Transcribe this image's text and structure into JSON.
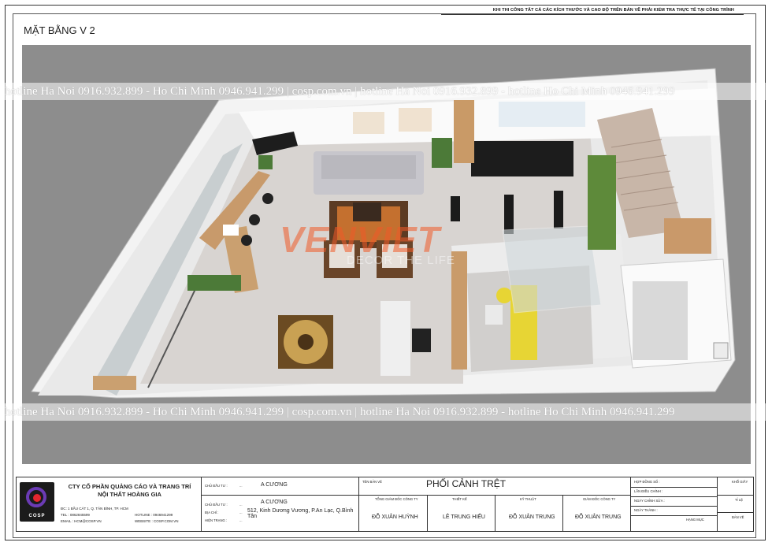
{
  "top_note": "KHI THI CÔNG TẤT CẢ CÁC KÍCH THƯỚC VÀ CAO ĐỘ TRÊN BẢN VẼ PHẢI KIỂM TRA THỰC TẾ TẠI CÔNG TRÌNH",
  "sheet_title": "MẶT BẰNG V 2",
  "hotline_text": "hotline Ha Noi 0916.932.899 - Ho Chi Minh 0946.941.299 | cosp.com.vn | hotline Ha Noi 0916.932.899 - hotline Ho Chi Minh 0946.941.299",
  "watermark": {
    "brand": "VENVIET",
    "tagline": "DECOR THE LIFE"
  },
  "colors": {
    "canvas": "#8d8d8d",
    "wall": "#f2f2f2",
    "floor": "#d9d5d2",
    "accent": "#f05a28",
    "logo_purple": "#6b3bb5",
    "logo_red": "#e3262e"
  },
  "title_block": {
    "company_line1": "CTY CỔ PHẦN QUẢNG CÁO VÀ TRANG TRÍ",
    "company_line2": "NỘI THẤT HOÀNG GIA",
    "logo_text": "COSP",
    "address": "ĐC: 1 BẦU CÁT 1, Q. TÂN BÌNH, TP. HCM",
    "tel_label": "TEL :",
    "tel": "0862845599",
    "hotline_label": "HOTLINE :",
    "hotline": "0946941299",
    "email_label": "EMAIL :",
    "email": "HCM@COSP.VN",
    "website_label": "WEBSITE :",
    "website": "COSP.COM.VN",
    "owner_label": "CHỦ ĐẦU TƯ :",
    "owner_name": "A   CƯƠNG",
    "owner_label2": "CHỦ ĐẦU TƯ :",
    "owner_name2": "A   CƯƠNG",
    "location_label": "ĐỊA CHỈ :",
    "location": "512, Kinh Dương Vương, P.An Lạc, Q.Bình Tân",
    "item_label": "HIỆN TRẠNG :",
    "drawing_name_label": "TÊN BẢN VẼ",
    "drawing_name": "PHỐI CẢNH TRỆT",
    "roles": [
      {
        "label": "TỔNG GIÁM ĐỐC CÔNG TY",
        "name": "ĐỖ XUÂN HUỲNH"
      },
      {
        "label": "THIẾT KẾ",
        "name": "LÊ TRUNG HIẾU"
      },
      {
        "label": "KỸ THUẬT",
        "name": "ĐỖ XUÂN TRUNG"
      },
      {
        "label": "GIÁM ĐỐC CÔNG TY",
        "name": "ĐỖ XUÂN TRUNG"
      }
    ],
    "meta_rows": [
      "HỢP ĐỒNG SỐ :",
      "LẦN ĐIỀU CHỈNH :",
      "NGÀY CHỈNH SỬA :",
      "NGÀY THÀNH :",
      "HẠNG MỤC"
    ],
    "right_labels": [
      "KHỔ GIẤY",
      "TỈ LỆ",
      "BẢN VẼ"
    ]
  }
}
